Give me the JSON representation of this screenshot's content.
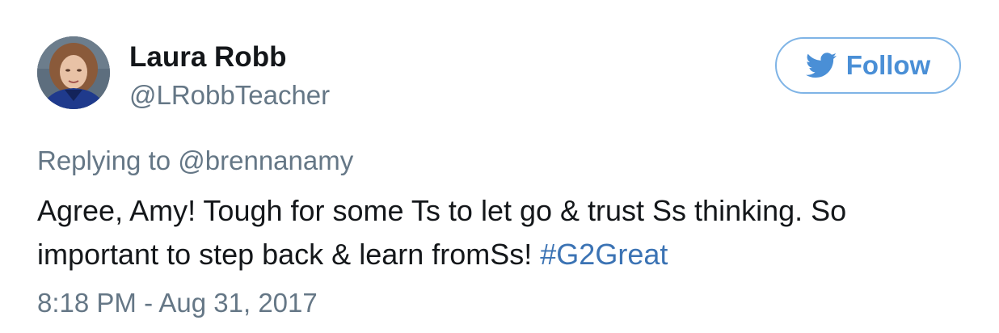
{
  "author": {
    "display_name": "Laura Robb",
    "handle": "@LRobbTeacher",
    "avatar": "profile-photo"
  },
  "follow_button": {
    "label": "Follow",
    "icon": "twitter-bird-icon",
    "border_color": "#7fb4e6",
    "text_color": "#4a8fd6"
  },
  "reply": {
    "prefix": "Replying to",
    "mention": "@brennanamy"
  },
  "tweet": {
    "line1": "Agree, Amy! Tough for some Ts to let go & trust Ss thinking. So",
    "line2": "important to step back & learn fromSs!",
    "hashtag": "#G2Great",
    "hashtag_color": "#3b73b4"
  },
  "timestamp": "8:18 PM - Aug 31, 2017"
}
